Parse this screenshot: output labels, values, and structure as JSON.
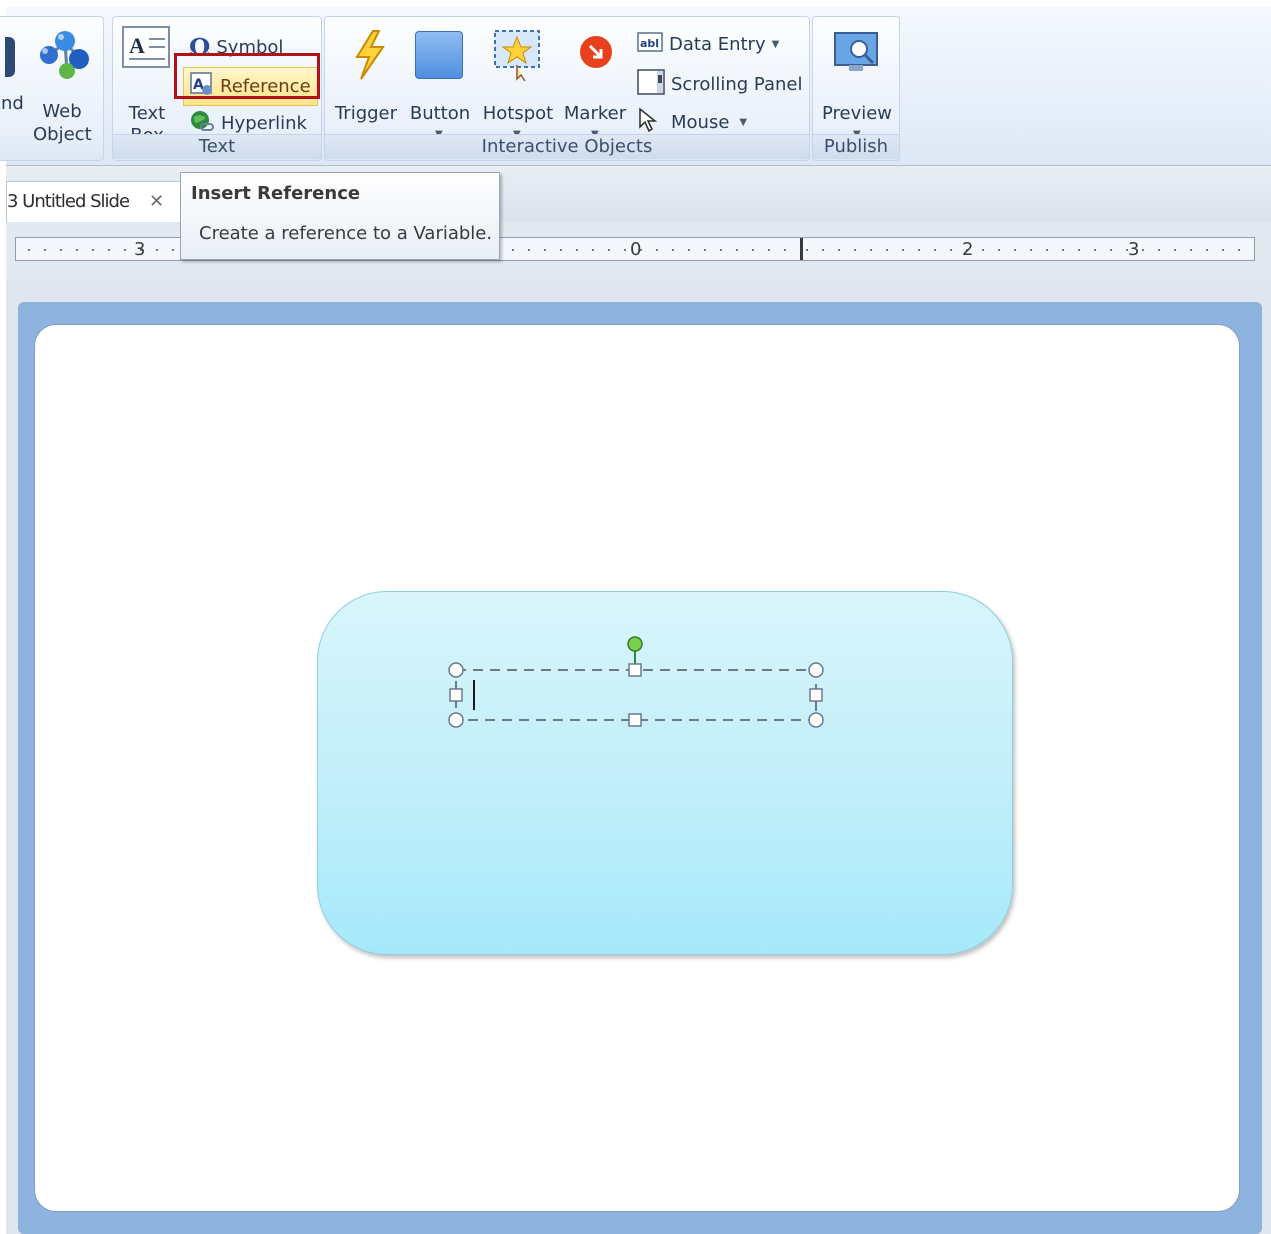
{
  "ribbon": {
    "partial_left_label": "nd",
    "web_object": {
      "line1": "Web",
      "line2": "Object"
    },
    "text_group": {
      "label": "Text",
      "text_box": {
        "line1": "Text",
        "line2": "Box"
      },
      "symbol": "Symbol",
      "reference": "Reference",
      "hyperlink": "Hyperlink"
    },
    "interactive_group": {
      "label": "Interactive Objects",
      "trigger": "Trigger",
      "button": "Button",
      "hotspot": "Hotspot",
      "marker": "Marker",
      "data_entry": "Data Entry",
      "scrolling_panel": "Scrolling Panel",
      "mouse": "Mouse"
    },
    "publish_group": {
      "label": "Publish",
      "preview": "Preview"
    }
  },
  "doc_tab": {
    "title": "3 Untitled Slide",
    "close": "✕"
  },
  "ruler": {
    "labels": [
      "3",
      "0",
      "2",
      "3"
    ]
  },
  "tooltip": {
    "title": "Insert Reference",
    "description": "Create a reference to a Variable."
  },
  "colors": {
    "highlight": "#b0121a",
    "slide_frame": "#8fb3df",
    "shape_top": "#d9f5fb",
    "shape_bottom": "#a6e9fb",
    "rotate_handle": "#7ad14a"
  },
  "icons": [
    "web-object-icon",
    "text-box-icon",
    "omega-icon",
    "reference-icon",
    "hyperlink-icon",
    "trigger-icon",
    "button-icon",
    "hotspot-icon",
    "marker-icon",
    "data-entry-icon",
    "scrolling-panel-icon",
    "mouse-icon",
    "preview-icon"
  ]
}
